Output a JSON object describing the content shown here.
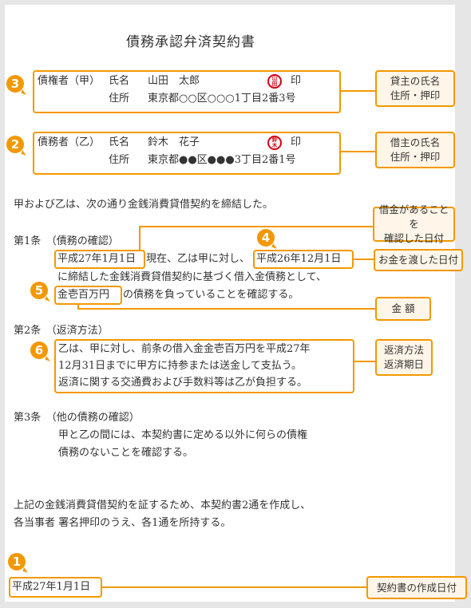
{
  "document": {
    "title": "債務承認弁済契約書",
    "creditor": {
      "role": "債権者（甲）",
      "name_label": "氏名",
      "name": "山田　太郎",
      "seal_text": [
        "山",
        "田"
      ],
      "seal_mark": "印",
      "address_label": "住所",
      "address": "東京都○○区○○○1丁目2番3号"
    },
    "debtor": {
      "role": "債務者（乙）",
      "name_label": "氏名",
      "name": "鈴木　花子",
      "seal_text": [
        "鈴",
        "木"
      ],
      "seal_mark": "印",
      "address_label": "住所",
      "address": "東京都●●区●●●3丁目2番1号"
    },
    "intro": "甲および乙は、次の通り金銭消費貸借契約を締結した。",
    "article1": {
      "heading": "第1条　（債務の確認）",
      "date_confirmed": "平成27年1月1日",
      "line1_mid": "現在、乙は甲に対し、",
      "date_lent": "平成26年12月1日",
      "line2": "に締結した金銭消費貸借契約に基づく借入金債務として、",
      "amount": "金壱百万円",
      "line3_rest": "の債務を負っていることを確認する。"
    },
    "article2": {
      "heading": "第2条　（返済方法）",
      "lines": [
        "乙は、甲に対し、前条の借入金金壱百万円を平成27年",
        "12月31日までに甲方に持参または送金して支払う。",
        "返済に関する交通費および手数料等は乙が負担する。"
      ]
    },
    "article3": {
      "heading": "第3条　（他の債務の確認）",
      "lines": [
        "甲と乙の間には、本契約書に定める以外に何らの債権",
        "債務のないことを確認する。"
      ]
    },
    "closing": [
      "上記の金銭消費貸借契約を証するため、本契約書2通を作成し、",
      "各当事者 署名押印のうえ、各1通を所持する。"
    ],
    "creation_date": "平成27年1月1日"
  },
  "annotations": {
    "badges": [
      "3",
      "2",
      "4",
      "5",
      "6",
      "1"
    ],
    "callouts": {
      "lender": [
        "貸主の氏名",
        "住所・押印"
      ],
      "borrower": [
        "借主の氏名",
        "住所・押印"
      ],
      "debt_confirmed_date": [
        "借金があることを",
        "確認した日付"
      ],
      "lent_date": [
        "お金を渡した日付"
      ],
      "amount": [
        "金 額"
      ],
      "repayment": [
        "返済方法",
        "返済期日"
      ],
      "creation_date": [
        "契約書の作成日付"
      ]
    },
    "accent_color": "#f39800",
    "callout_fill": "#fff5e8",
    "seal_color": "#d7000f"
  }
}
